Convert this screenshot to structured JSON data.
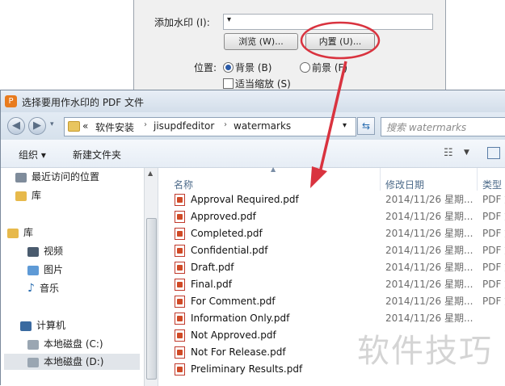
{
  "watermark_dialog": {
    "add_watermark_label": "添加水印 (I):",
    "combo_value": "",
    "browse_button": "浏览 (W)...",
    "builtin_button": "内置 (U)...",
    "position_label": "位置:",
    "background_option": "背景 (B)",
    "foreground_option": "前景 (F)",
    "fit_checkbox": "适当缩放 (S)"
  },
  "file_dialog": {
    "title": "选择要用作水印的 PDF 文件",
    "breadcrumb_prefix": "«",
    "breadcrumb": [
      "软件安装",
      "jisupdfeditor",
      "watermarks"
    ],
    "search_placeholder": "搜索 watermarks",
    "toolbar": {
      "organize": "组织 ▾",
      "new_folder": "新建文件夹"
    },
    "nav": {
      "recent": "最近访问的位置",
      "library_top": "库",
      "library": "库",
      "videos": "视频",
      "pictures": "图片",
      "music": "音乐",
      "computer": "计算机",
      "drive_c": "本地磁盘 (C:)",
      "drive_d": "本地磁盘 (D:)"
    },
    "columns": {
      "name": "名称",
      "date": "修改日期",
      "type": "类型"
    },
    "files": [
      {
        "name": "Approval Required.pdf",
        "date": "2014/11/26 星期...",
        "type": "PDF 文"
      },
      {
        "name": "Approved.pdf",
        "date": "2014/11/26 星期...",
        "type": "PDF 文"
      },
      {
        "name": "Completed.pdf",
        "date": "2014/11/26 星期...",
        "type": "PDF 文"
      },
      {
        "name": "Confidential.pdf",
        "date": "2014/11/26 星期...",
        "type": "PDF 文"
      },
      {
        "name": "Draft.pdf",
        "date": "2014/11/26 星期...",
        "type": "PDF 文"
      },
      {
        "name": "Final.pdf",
        "date": "2014/11/26 星期...",
        "type": "PDF 文"
      },
      {
        "name": "For Comment.pdf",
        "date": "2014/11/26 星期...",
        "type": "PDF 文"
      },
      {
        "name": "Information Only.pdf",
        "date": "2014/11/26 星期...",
        "type": ""
      },
      {
        "name": "Not Approved.pdf",
        "date": "",
        "type": ""
      },
      {
        "name": "Not For Release.pdf",
        "date": "",
        "type": ""
      },
      {
        "name": "Preliminary Results.pdf",
        "date": "",
        "type": ""
      }
    ]
  },
  "site_watermark": "软件技巧",
  "colors": {
    "annotation": "#d9333f",
    "accent": "#2a5aa8"
  }
}
